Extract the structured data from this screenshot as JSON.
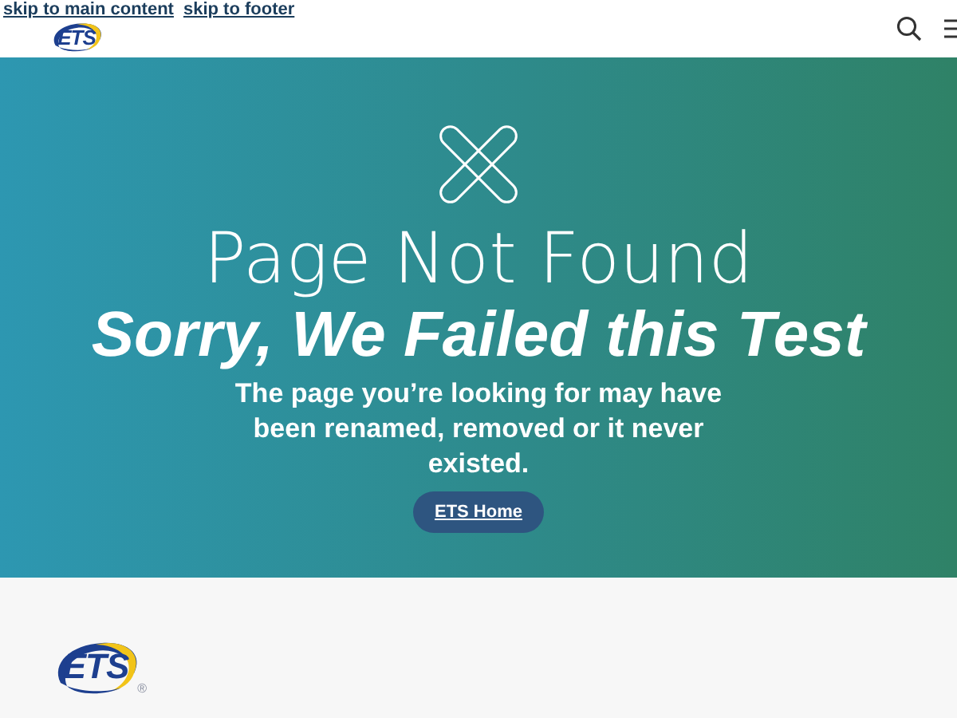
{
  "skip_links": [
    "skip to main content",
    "skip to footer"
  ],
  "header": {
    "logo": "ETS"
  },
  "hero": {
    "title": "Page Not Found",
    "subtitle": "Sorry, We Failed this Test",
    "message": "The page you’re looking for may have been renamed, removed or it never existed.",
    "button": "ETS Home"
  },
  "footer": {
    "logo": "ETS",
    "registered": "®"
  }
}
